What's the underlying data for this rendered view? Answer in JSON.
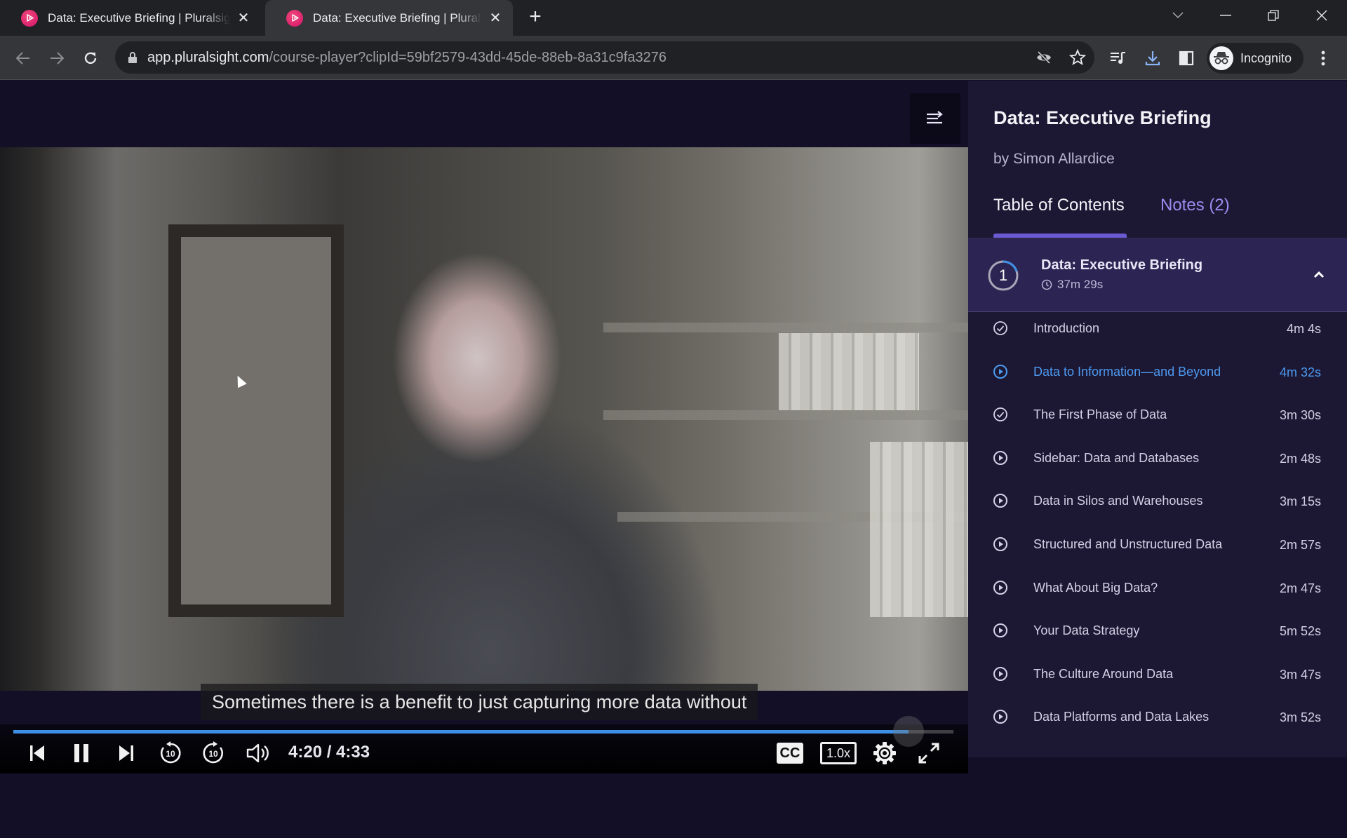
{
  "browser": {
    "tabs": [
      {
        "title": "Data: Executive Briefing | Pluralsight",
        "active": false
      },
      {
        "title": "Data: Executive Briefing | Pluralsight",
        "active": true
      }
    ],
    "url_host": "app.pluralsight.com",
    "url_path": "/course-player?clipId=59bf2579-43dd-45de-88eb-8a31c9fa3276",
    "profile_label": "Incognito",
    "icons": [
      "back-icon",
      "forward-icon",
      "reload-icon",
      "lock-icon",
      "eye-off-icon",
      "star-icon",
      "media-control-icon",
      "download-icon",
      "side-panel-icon",
      "incognito-icon",
      "kebab-menu-icon"
    ]
  },
  "player": {
    "subtitle": "Sometimes there is a benefit to just capturing more data without",
    "current_time": "4:20",
    "total_time": "4:33",
    "time_display": "4:20 / 4:33",
    "progress_fraction": 0.952,
    "cc_label": "CC",
    "speed_label": "1.0x",
    "colors": {
      "progress": "#3c8fe5"
    }
  },
  "sidebar": {
    "course_title": "Data: Executive Briefing",
    "author": "by Simon Allardice",
    "tabs": [
      {
        "label": "Table of Contents",
        "active": true
      },
      {
        "label": "Notes (2)",
        "active": false
      }
    ],
    "module": {
      "number": "1",
      "title": "Data: Executive Briefing",
      "duration": "37m 29s",
      "progress_fraction": 0.2,
      "expanded": true
    },
    "clips": [
      {
        "title": "Introduction",
        "duration": "4m 4s",
        "status": "completed"
      },
      {
        "title": "Data to Information—and Beyond",
        "duration": "4m 32s",
        "status": "current"
      },
      {
        "title": "The First Phase of Data",
        "duration": "3m 30s",
        "status": "completed"
      },
      {
        "title": "Sidebar: Data and Databases",
        "duration": "2m 48s",
        "status": "not-started"
      },
      {
        "title": "Data in Silos and Warehouses",
        "duration": "3m 15s",
        "status": "not-started"
      },
      {
        "title": "Structured and Unstructured Data",
        "duration": "2m 57s",
        "status": "not-started"
      },
      {
        "title": "What About Big Data?",
        "duration": "2m 47s",
        "status": "not-started"
      },
      {
        "title": "Your Data Strategy",
        "duration": "5m 52s",
        "status": "not-started"
      },
      {
        "title": "The Culture Around Data",
        "duration": "3m 47s",
        "status": "not-started"
      },
      {
        "title": "Data Platforms and Data Lakes",
        "duration": "3m 52s",
        "status": "not-started"
      }
    ],
    "colors": {
      "accent": "#6a5ad2",
      "current_clip": "#4d9af0",
      "notes_tab": "#9d8cf0"
    }
  }
}
